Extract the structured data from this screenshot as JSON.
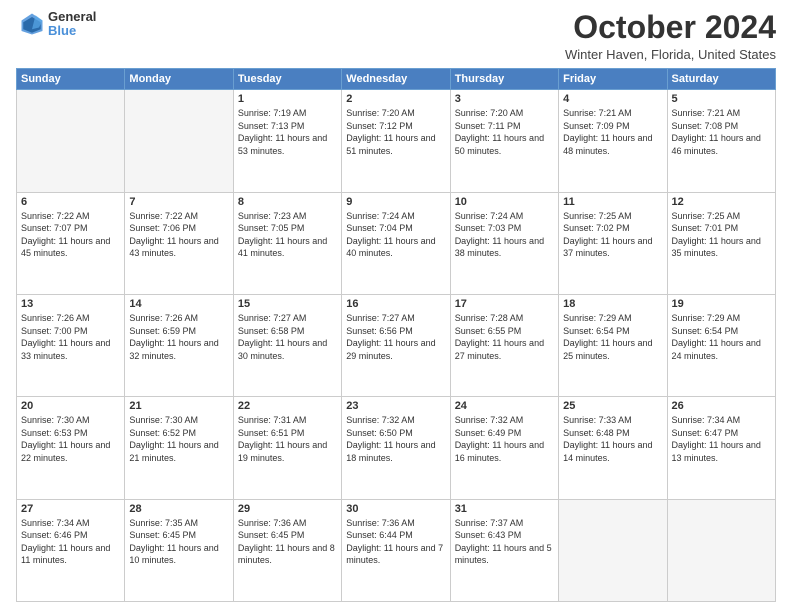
{
  "logo": {
    "general": "General",
    "blue": "Blue"
  },
  "header": {
    "month": "October 2024",
    "location": "Winter Haven, Florida, United States"
  },
  "weekdays": [
    "Sunday",
    "Monday",
    "Tuesday",
    "Wednesday",
    "Thursday",
    "Friday",
    "Saturday"
  ],
  "weeks": [
    [
      {
        "day": "",
        "empty": true
      },
      {
        "day": "",
        "empty": true
      },
      {
        "day": "1",
        "sunrise": "7:19 AM",
        "sunset": "7:13 PM",
        "daylight": "11 hours and 53 minutes."
      },
      {
        "day": "2",
        "sunrise": "7:20 AM",
        "sunset": "7:12 PM",
        "daylight": "11 hours and 51 minutes."
      },
      {
        "day": "3",
        "sunrise": "7:20 AM",
        "sunset": "7:11 PM",
        "daylight": "11 hours and 50 minutes."
      },
      {
        "day": "4",
        "sunrise": "7:21 AM",
        "sunset": "7:09 PM",
        "daylight": "11 hours and 48 minutes."
      },
      {
        "day": "5",
        "sunrise": "7:21 AM",
        "sunset": "7:08 PM",
        "daylight": "11 hours and 46 minutes."
      }
    ],
    [
      {
        "day": "6",
        "sunrise": "7:22 AM",
        "sunset": "7:07 PM",
        "daylight": "11 hours and 45 minutes."
      },
      {
        "day": "7",
        "sunrise": "7:22 AM",
        "sunset": "7:06 PM",
        "daylight": "11 hours and 43 minutes."
      },
      {
        "day": "8",
        "sunrise": "7:23 AM",
        "sunset": "7:05 PM",
        "daylight": "11 hours and 41 minutes."
      },
      {
        "day": "9",
        "sunrise": "7:24 AM",
        "sunset": "7:04 PM",
        "daylight": "11 hours and 40 minutes."
      },
      {
        "day": "10",
        "sunrise": "7:24 AM",
        "sunset": "7:03 PM",
        "daylight": "11 hours and 38 minutes."
      },
      {
        "day": "11",
        "sunrise": "7:25 AM",
        "sunset": "7:02 PM",
        "daylight": "11 hours and 37 minutes."
      },
      {
        "day": "12",
        "sunrise": "7:25 AM",
        "sunset": "7:01 PM",
        "daylight": "11 hours and 35 minutes."
      }
    ],
    [
      {
        "day": "13",
        "sunrise": "7:26 AM",
        "sunset": "7:00 PM",
        "daylight": "11 hours and 33 minutes."
      },
      {
        "day": "14",
        "sunrise": "7:26 AM",
        "sunset": "6:59 PM",
        "daylight": "11 hours and 32 minutes."
      },
      {
        "day": "15",
        "sunrise": "7:27 AM",
        "sunset": "6:58 PM",
        "daylight": "11 hours and 30 minutes."
      },
      {
        "day": "16",
        "sunrise": "7:27 AM",
        "sunset": "6:56 PM",
        "daylight": "11 hours and 29 minutes."
      },
      {
        "day": "17",
        "sunrise": "7:28 AM",
        "sunset": "6:55 PM",
        "daylight": "11 hours and 27 minutes."
      },
      {
        "day": "18",
        "sunrise": "7:29 AM",
        "sunset": "6:54 PM",
        "daylight": "11 hours and 25 minutes."
      },
      {
        "day": "19",
        "sunrise": "7:29 AM",
        "sunset": "6:54 PM",
        "daylight": "11 hours and 24 minutes."
      }
    ],
    [
      {
        "day": "20",
        "sunrise": "7:30 AM",
        "sunset": "6:53 PM",
        "daylight": "11 hours and 22 minutes."
      },
      {
        "day": "21",
        "sunrise": "7:30 AM",
        "sunset": "6:52 PM",
        "daylight": "11 hours and 21 minutes."
      },
      {
        "day": "22",
        "sunrise": "7:31 AM",
        "sunset": "6:51 PM",
        "daylight": "11 hours and 19 minutes."
      },
      {
        "day": "23",
        "sunrise": "7:32 AM",
        "sunset": "6:50 PM",
        "daylight": "11 hours and 18 minutes."
      },
      {
        "day": "24",
        "sunrise": "7:32 AM",
        "sunset": "6:49 PM",
        "daylight": "11 hours and 16 minutes."
      },
      {
        "day": "25",
        "sunrise": "7:33 AM",
        "sunset": "6:48 PM",
        "daylight": "11 hours and 14 minutes."
      },
      {
        "day": "26",
        "sunrise": "7:34 AM",
        "sunset": "6:47 PM",
        "daylight": "11 hours and 13 minutes."
      }
    ],
    [
      {
        "day": "27",
        "sunrise": "7:34 AM",
        "sunset": "6:46 PM",
        "daylight": "11 hours and 11 minutes."
      },
      {
        "day": "28",
        "sunrise": "7:35 AM",
        "sunset": "6:45 PM",
        "daylight": "11 hours and 10 minutes."
      },
      {
        "day": "29",
        "sunrise": "7:36 AM",
        "sunset": "6:45 PM",
        "daylight": "11 hours and 8 minutes."
      },
      {
        "day": "30",
        "sunrise": "7:36 AM",
        "sunset": "6:44 PM",
        "daylight": "11 hours and 7 minutes."
      },
      {
        "day": "31",
        "sunrise": "7:37 AM",
        "sunset": "6:43 PM",
        "daylight": "11 hours and 5 minutes."
      },
      {
        "day": "",
        "empty": true
      },
      {
        "day": "",
        "empty": true
      }
    ]
  ]
}
